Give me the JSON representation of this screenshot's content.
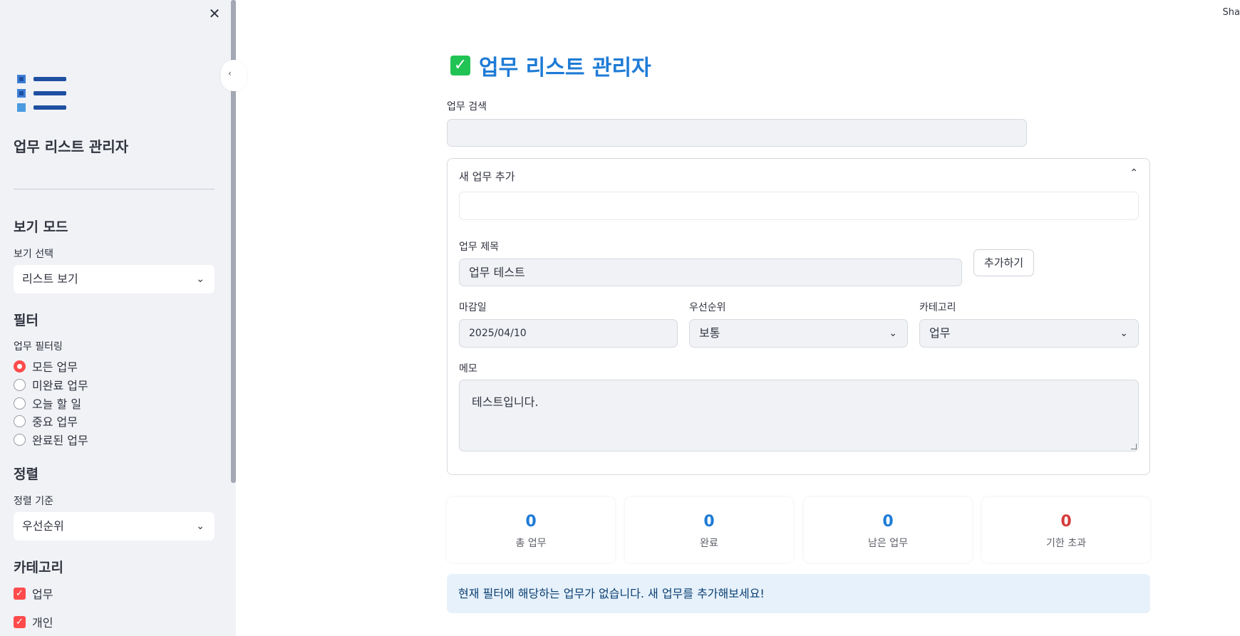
{
  "header": {
    "share_label": "Sha"
  },
  "sidebar": {
    "title": "업무 리스트 관리자",
    "view_mode": {
      "heading": "보기 모드",
      "label": "보기 선택",
      "selected": "리스트 보기"
    },
    "filter": {
      "heading": "필터",
      "label": "업무 필터링",
      "options": [
        "모든 업무",
        "미완료 업무",
        "오늘 할 일",
        "중요 업무",
        "완료된 업무"
      ],
      "selected_index": 0
    },
    "sort": {
      "heading": "정렬",
      "label": "정렬 기준",
      "selected": "우선순위"
    },
    "category": {
      "heading": "카테고리",
      "items": [
        {
          "label": "업무",
          "checked": true
        },
        {
          "label": "개인",
          "checked": true
        }
      ]
    }
  },
  "main": {
    "title": "업무 리스트 관리자",
    "search": {
      "label": "업무 검색",
      "value": ""
    },
    "new_task": {
      "header": "새 업무 추가",
      "title_label": "업무 제목",
      "title_value": "업무 테스트",
      "add_button": "추가하기",
      "due_label": "마감일",
      "due_value": "2025/04/10",
      "priority_label": "우선순위",
      "priority_value": "보통",
      "category_label": "카테고리",
      "category_value": "업무",
      "memo_label": "메모",
      "memo_value": "테스트입니다."
    },
    "stats": [
      {
        "value": "0",
        "label": "총 업무"
      },
      {
        "value": "0",
        "label": "완료"
      },
      {
        "value": "0",
        "label": "남은 업무"
      },
      {
        "value": "0",
        "label": "기한 초과"
      }
    ],
    "info_message": "현재 필터에 해당하는 업무가 없습니다. 새 업무를 추가해보세요!"
  },
  "colors": {
    "accent": "#1e7bd6",
    "danger": "#d63c3c",
    "primary": "#ff4b4b",
    "success": "#21c354",
    "info_bg": "#e6f1fb"
  }
}
